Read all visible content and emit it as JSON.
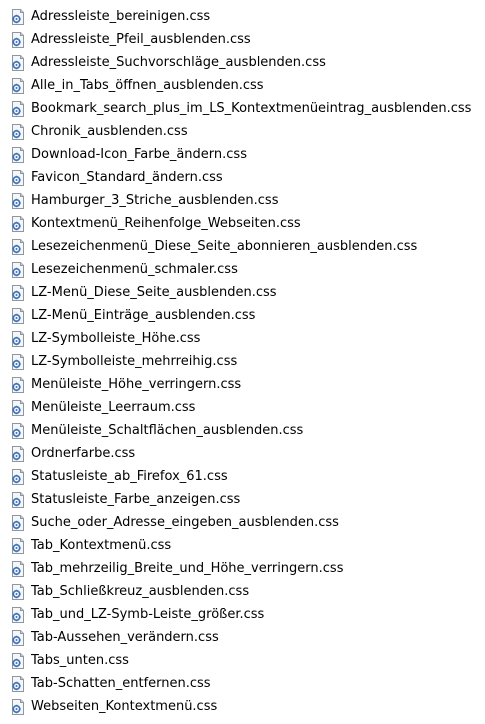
{
  "files": [
    {
      "name": "Adressleiste_bereinigen.css",
      "icon": "css-file-icon"
    },
    {
      "name": "Adressleiste_Pfeil_ausblenden.css",
      "icon": "css-file-icon"
    },
    {
      "name": "Adressleiste_Suchvorschläge_ausblenden.css",
      "icon": "css-file-icon"
    },
    {
      "name": "Alle_in_Tabs_öffnen_ausblenden.css",
      "icon": "css-file-icon"
    },
    {
      "name": "Bookmark_search_plus_im_LS_Kontextmenüeintrag_ausblenden.css",
      "icon": "css-file-icon"
    },
    {
      "name": "Chronik_ausblenden.css",
      "icon": "css-file-icon"
    },
    {
      "name": "Download-Icon_Farbe_ändern.css",
      "icon": "css-file-icon"
    },
    {
      "name": "Favicon_Standard_ändern.css",
      "icon": "css-file-icon"
    },
    {
      "name": "Hamburger_3_Striche_ausblenden.css",
      "icon": "css-file-icon"
    },
    {
      "name": "Kontextmenü_Reihenfolge_Webseiten.css",
      "icon": "css-file-icon"
    },
    {
      "name": "Lesezeichenmenü_Diese_Seite_abonnieren_ausblenden.css",
      "icon": "css-file-icon"
    },
    {
      "name": "Lesezeichenmenü_schmaler.css",
      "icon": "css-file-icon"
    },
    {
      "name": "LZ-Menü_Diese_Seite_ausblenden.css",
      "icon": "css-file-icon"
    },
    {
      "name": "LZ-Menü_Einträge_ausblenden.css",
      "icon": "css-file-icon"
    },
    {
      "name": "LZ-Symbolleiste_Höhe.css",
      "icon": "css-file-icon"
    },
    {
      "name": "LZ-Symbolleiste_mehrreihig.css",
      "icon": "css-file-icon"
    },
    {
      "name": "Menüleiste_Höhe_verringern.css",
      "icon": "css-file-icon"
    },
    {
      "name": "Menüleiste_Leerraum.css",
      "icon": "css-file-icon"
    },
    {
      "name": "Menüleiste_Schaltflächen_ausblenden.css",
      "icon": "css-file-icon"
    },
    {
      "name": "Ordnerfarbe.css",
      "icon": "css-file-icon"
    },
    {
      "name": "Statusleiste_ab_Firefox_61.css",
      "icon": "css-file-icon"
    },
    {
      "name": "Statusleiste_Farbe_anzeigen.css",
      "icon": "css-file-icon"
    },
    {
      "name": "Suche_oder_Adresse_eingeben_ausblenden.css",
      "icon": "css-file-icon"
    },
    {
      "name": "Tab_Kontextmenü.css",
      "icon": "css-file-icon"
    },
    {
      "name": "Tab_mehrzeilig_Breite_und_Höhe_verringern.css",
      "icon": "css-file-icon"
    },
    {
      "name": "Tab_Schließkreuz_ausblenden.css",
      "icon": "css-file-icon"
    },
    {
      "name": "Tab_und_LZ-Symb-Leiste_größer.css",
      "icon": "css-file-icon"
    },
    {
      "name": "Tab-Aussehen_verändern.css",
      "icon": "css-file-icon"
    },
    {
      "name": "Tabs_unten.css",
      "icon": "css-file-icon"
    },
    {
      "name": "Tab-Schatten_entfernen.css",
      "icon": "css-file-icon"
    },
    {
      "name": "Webseiten_Kontextmenü.css",
      "icon": "css-file-icon"
    }
  ],
  "colors": {
    "text": "#000000",
    "page_fold": "#c8ccd2",
    "page_body": "#f4f6f8",
    "page_border": "#8e96a0",
    "gear": "#3d72b8"
  }
}
